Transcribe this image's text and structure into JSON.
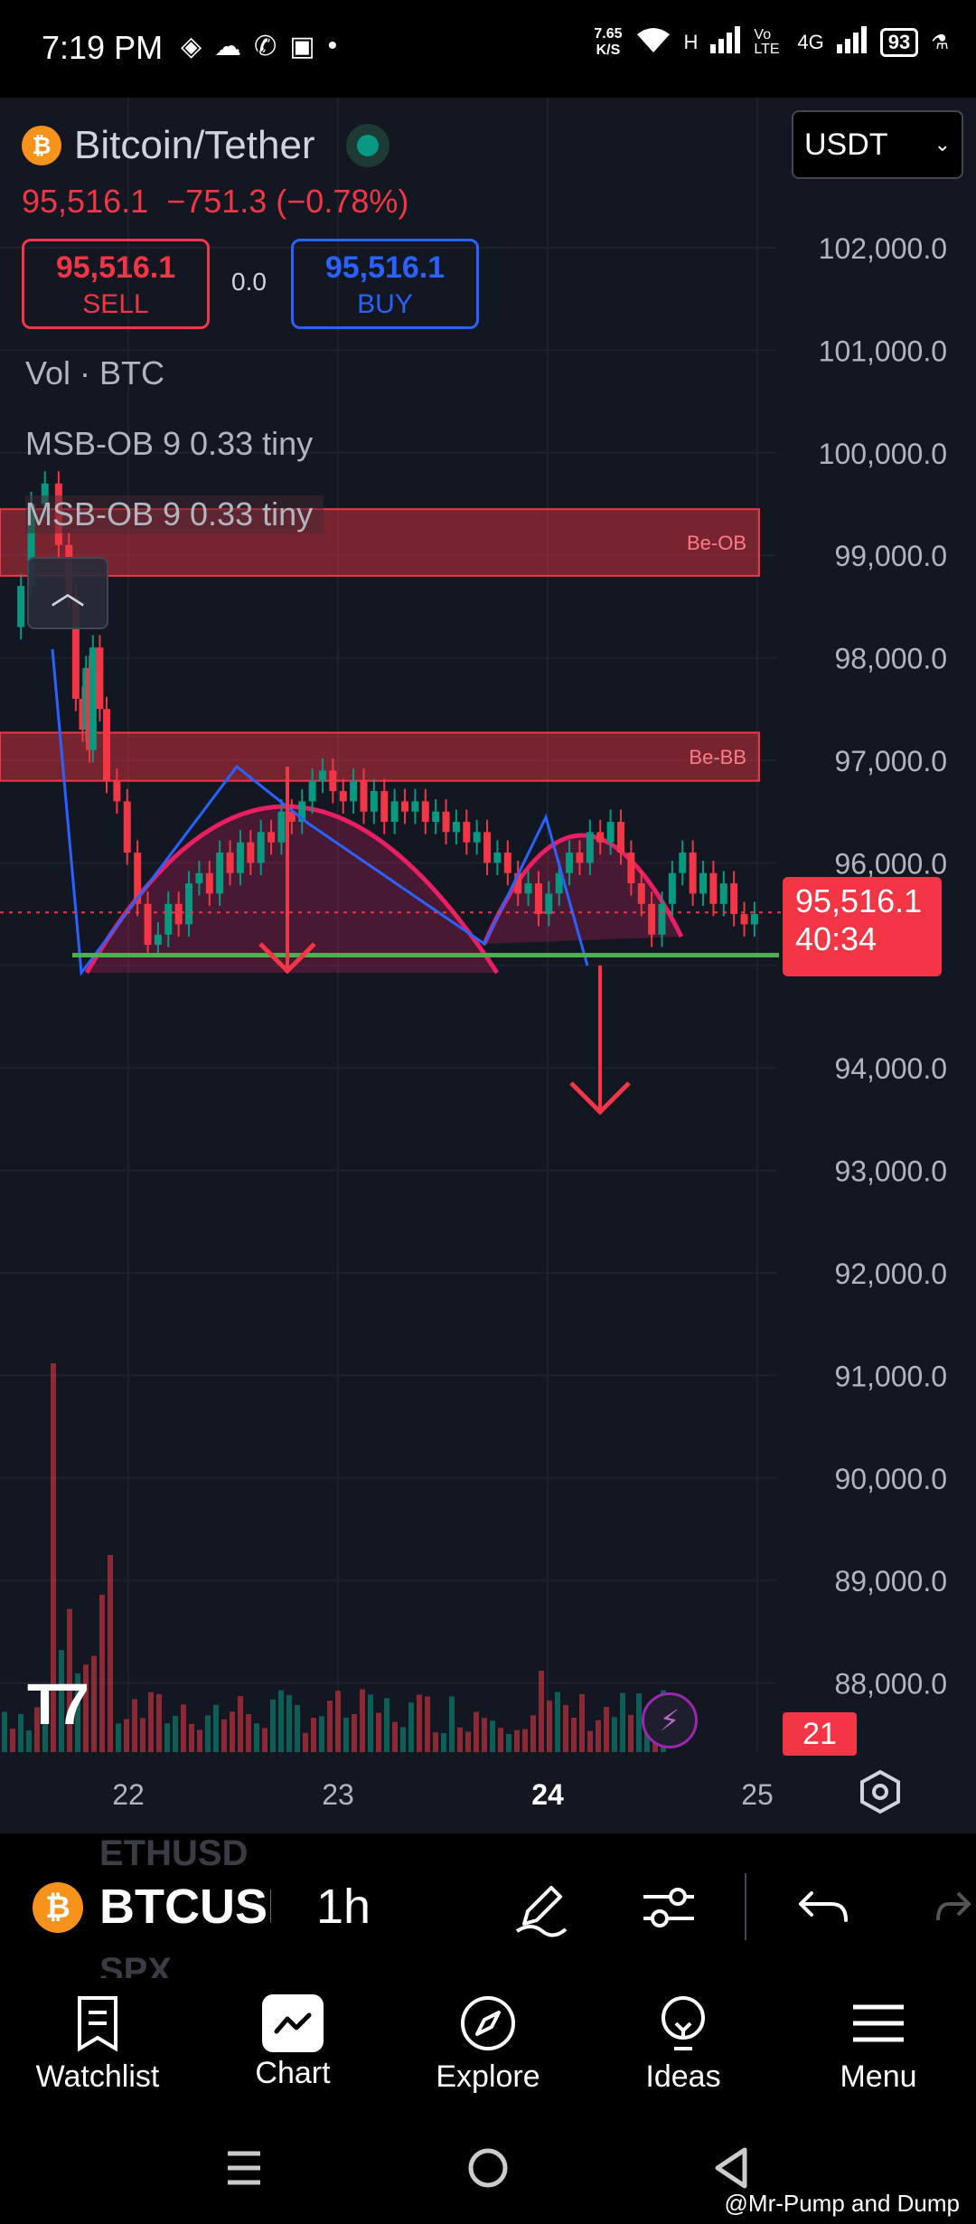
{
  "status_bar": {
    "time": "7:19 PM",
    "net_speed_value": "7.65",
    "net_speed_unit": "K/S",
    "network": "H",
    "volte": "Vo LTE",
    "signal_4g": "4G",
    "battery": "93"
  },
  "header": {
    "symbol_logo": "₿",
    "title": "Bitcoin/Tether",
    "price": "95,516.1",
    "change": "−751.3",
    "change_pct": "(−0.78%)",
    "currency": "USDT",
    "sell_price": "95,516.1",
    "sell_label": "SELL",
    "buy_price": "95,516.1",
    "buy_label": "BUY",
    "spread": "0.0"
  },
  "legend": {
    "vol": "Vol · BTC",
    "indicator1": "MSB-OB 9 0.33 tiny",
    "indicator2": "MSB-OB 9 0.33 tiny"
  },
  "price_badge": {
    "value": "95,516.1",
    "timer": "40:34"
  },
  "volume_badge": "21",
  "chart_data": {
    "type": "candlestick",
    "y_axis_labels": [
      "102,000.0",
      "101,000.0",
      "100,000.0",
      "99,000.0",
      "98,000.0",
      "97,000.0",
      "96,000.0",
      "94,000.0",
      "93,000.0",
      "92,000.0",
      "91,000.0",
      "90,000.0",
      "89,000.0",
      "88,000.0"
    ],
    "y_axis_values": [
      102000,
      101000,
      100000,
      99000,
      98000,
      97000,
      96000,
      94000,
      93000,
      92000,
      91000,
      90000,
      89000,
      88000
    ],
    "ylim": [
      87300,
      103000
    ],
    "x_axis_labels": [
      "22",
      "23",
      "24",
      "25"
    ],
    "x_axis_emphasis": "24",
    "current_price": 95516.1,
    "zones": [
      {
        "label": "Be-OB",
        "top": 99450,
        "bottom": 98800
      },
      {
        "label": "Be-BB",
        "top": 97270,
        "bottom": 96800
      }
    ],
    "support_level": 95100,
    "colors": {
      "up": "#089981",
      "down": "#f23645",
      "zone": "#f23645",
      "support": "#4caf50",
      "trend": "#2962ff",
      "pattern": "#e91e63"
    },
    "price_path": [
      [
        0,
        98300
      ],
      [
        8,
        98700
      ],
      [
        14,
        99500
      ],
      [
        22,
        99700
      ],
      [
        30,
        99100
      ],
      [
        36,
        98600
      ],
      [
        40,
        97600
      ],
      [
        44,
        97300
      ],
      [
        46,
        97900
      ],
      [
        48,
        97100
      ],
      [
        50,
        98100
      ],
      [
        54,
        97500
      ],
      [
        58,
        96800
      ],
      [
        64,
        96600
      ],
      [
        70,
        96100
      ],
      [
        76,
        95600
      ],
      [
        82,
        95200
      ],
      [
        88,
        95300
      ],
      [
        94,
        95600
      ],
      [
        100,
        95400
      ],
      [
        106,
        95800
      ],
      [
        112,
        95900
      ],
      [
        118,
        95700
      ],
      [
        124,
        96100
      ],
      [
        130,
        95900
      ],
      [
        136,
        96200
      ],
      [
        142,
        96000
      ],
      [
        148,
        96300
      ],
      [
        154,
        96200
      ],
      [
        160,
        96500
      ],
      [
        166,
        96400
      ],
      [
        172,
        96600
      ],
      [
        178,
        96800
      ],
      [
        184,
        96900
      ],
      [
        190,
        96700
      ],
      [
        196,
        96600
      ],
      [
        202,
        96800
      ],
      [
        208,
        96500
      ],
      [
        214,
        96700
      ],
      [
        220,
        96400
      ],
      [
        226,
        96600
      ],
      [
        232,
        96500
      ],
      [
        238,
        96600
      ],
      [
        244,
        96400
      ],
      [
        250,
        96500
      ],
      [
        256,
        96300
      ],
      [
        262,
        96400
      ],
      [
        268,
        96200
      ],
      [
        274,
        96300
      ],
      [
        280,
        96000
      ],
      [
        286,
        96100
      ],
      [
        292,
        95900
      ],
      [
        298,
        95700
      ],
      [
        304,
        95800
      ],
      [
        310,
        95500
      ],
      [
        316,
        95700
      ],
      [
        322,
        95900
      ],
      [
        328,
        96100
      ],
      [
        334,
        96000
      ],
      [
        340,
        96300
      ],
      [
        346,
        96200
      ],
      [
        352,
        96400
      ],
      [
        358,
        96100
      ],
      [
        364,
        95800
      ],
      [
        370,
        95600
      ],
      [
        376,
        95300
      ],
      [
        382,
        95600
      ],
      [
        388,
        95900
      ],
      [
        394,
        96100
      ],
      [
        400,
        95700
      ],
      [
        406,
        95900
      ],
      [
        412,
        95600
      ],
      [
        418,
        95800
      ],
      [
        424,
        95500
      ],
      [
        430,
        95400
      ],
      [
        436,
        95500
      ]
    ]
  },
  "toolbar": {
    "ghost_top": "ETHUSD",
    "symbol_logo": "₿",
    "symbol": "BTCUSDT",
    "interval": "1h",
    "ghost_bottom": "SPX"
  },
  "bottom_nav": [
    {
      "label": "Watchlist",
      "icon": "watchlist-icon"
    },
    {
      "label": "Chart",
      "icon": "chart-icon"
    },
    {
      "label": "Explore",
      "icon": "compass-icon"
    },
    {
      "label": "Ideas",
      "icon": "lightbulb-icon"
    },
    {
      "label": "Menu",
      "icon": "menu-icon"
    }
  ],
  "watermark": "@Mr-Pump and Dump"
}
